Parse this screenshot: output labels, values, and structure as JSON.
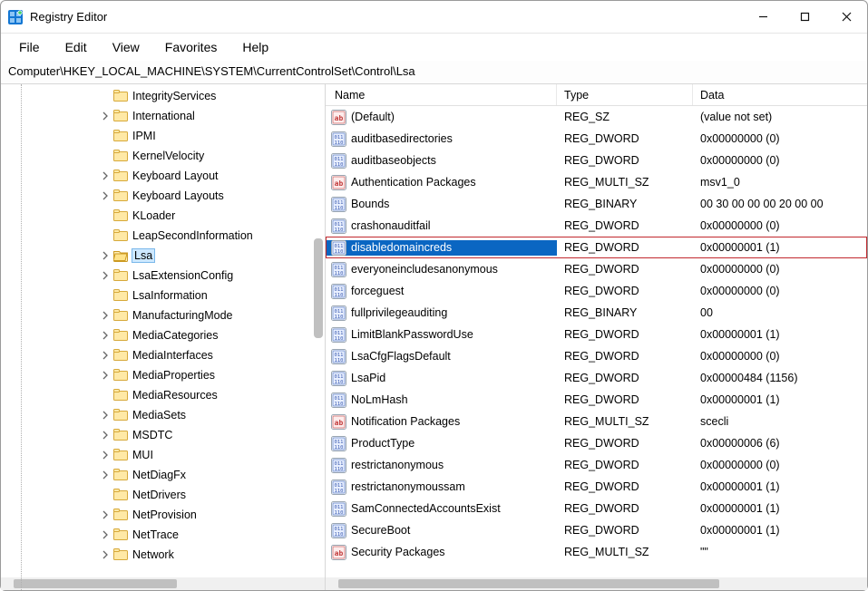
{
  "titlebar": {
    "title": "Registry Editor"
  },
  "menu": {
    "file": "File",
    "edit": "Edit",
    "view": "View",
    "favorites": "Favorites",
    "help": "Help"
  },
  "addressbar": {
    "path": "Computer\\HKEY_LOCAL_MACHINE\\SYSTEM\\CurrentControlSet\\Control\\Lsa"
  },
  "tree": {
    "items": [
      {
        "label": "IntegrityServices",
        "expandable": false
      },
      {
        "label": "International",
        "expandable": true
      },
      {
        "label": "IPMI",
        "expandable": false
      },
      {
        "label": "KernelVelocity",
        "expandable": false
      },
      {
        "label": "Keyboard Layout",
        "expandable": true
      },
      {
        "label": "Keyboard Layouts",
        "expandable": true
      },
      {
        "label": "KLoader",
        "expandable": false
      },
      {
        "label": "LeapSecondInformation",
        "expandable": false
      },
      {
        "label": "Lsa",
        "expandable": true,
        "selected": true
      },
      {
        "label": "LsaExtensionConfig",
        "expandable": true
      },
      {
        "label": "LsaInformation",
        "expandable": false
      },
      {
        "label": "ManufacturingMode",
        "expandable": true
      },
      {
        "label": "MediaCategories",
        "expandable": true
      },
      {
        "label": "MediaInterfaces",
        "expandable": true
      },
      {
        "label": "MediaProperties",
        "expandable": true
      },
      {
        "label": "MediaResources",
        "expandable": false
      },
      {
        "label": "MediaSets",
        "expandable": true
      },
      {
        "label": "MSDTC",
        "expandable": true
      },
      {
        "label": "MUI",
        "expandable": true
      },
      {
        "label": "NetDiagFx",
        "expandable": true
      },
      {
        "label": "NetDrivers",
        "expandable": false
      },
      {
        "label": "NetProvision",
        "expandable": true
      },
      {
        "label": "NetTrace",
        "expandable": true
      },
      {
        "label": "Network",
        "expandable": true
      }
    ]
  },
  "list": {
    "columns": {
      "name": "Name",
      "type": "Type",
      "data": "Data"
    },
    "rows": [
      {
        "icon": "string",
        "name": "(Default)",
        "type": "REG_SZ",
        "data": "(value not set)"
      },
      {
        "icon": "binary",
        "name": "auditbasedirectories",
        "type": "REG_DWORD",
        "data": "0x00000000 (0)"
      },
      {
        "icon": "binary",
        "name": "auditbaseobjects",
        "type": "REG_DWORD",
        "data": "0x00000000 (0)"
      },
      {
        "icon": "string",
        "name": "Authentication Packages",
        "type": "REG_MULTI_SZ",
        "data": "msv1_0"
      },
      {
        "icon": "binary",
        "name": "Bounds",
        "type": "REG_BINARY",
        "data": "00 30 00 00 00 20 00 00"
      },
      {
        "icon": "binary",
        "name": "crashonauditfail",
        "type": "REG_DWORD",
        "data": "0x00000000 (0)"
      },
      {
        "icon": "binary",
        "name": "disabledomaincreds",
        "type": "REG_DWORD",
        "data": "0x00000001 (1)",
        "selected": true,
        "highlight": true
      },
      {
        "icon": "binary",
        "name": "everyoneincludesanonymous",
        "type": "REG_DWORD",
        "data": "0x00000000 (0)"
      },
      {
        "icon": "binary",
        "name": "forceguest",
        "type": "REG_DWORD",
        "data": "0x00000000 (0)"
      },
      {
        "icon": "binary",
        "name": "fullprivilegeauditing",
        "type": "REG_BINARY",
        "data": "00"
      },
      {
        "icon": "binary",
        "name": "LimitBlankPasswordUse",
        "type": "REG_DWORD",
        "data": "0x00000001 (1)"
      },
      {
        "icon": "binary",
        "name": "LsaCfgFlagsDefault",
        "type": "REG_DWORD",
        "data": "0x00000000 (0)"
      },
      {
        "icon": "binary",
        "name": "LsaPid",
        "type": "REG_DWORD",
        "data": "0x00000484 (1156)"
      },
      {
        "icon": "binary",
        "name": "NoLmHash",
        "type": "REG_DWORD",
        "data": "0x00000001 (1)"
      },
      {
        "icon": "string",
        "name": "Notification Packages",
        "type": "REG_MULTI_SZ",
        "data": "scecli"
      },
      {
        "icon": "binary",
        "name": "ProductType",
        "type": "REG_DWORD",
        "data": "0x00000006 (6)"
      },
      {
        "icon": "binary",
        "name": "restrictanonymous",
        "type": "REG_DWORD",
        "data": "0x00000000 (0)"
      },
      {
        "icon": "binary",
        "name": "restrictanonymoussam",
        "type": "REG_DWORD",
        "data": "0x00000001 (1)"
      },
      {
        "icon": "binary",
        "name": "SamConnectedAccountsExist",
        "type": "REG_DWORD",
        "data": "0x00000001 (1)"
      },
      {
        "icon": "binary",
        "name": "SecureBoot",
        "type": "REG_DWORD",
        "data": "0x00000001 (1)"
      },
      {
        "icon": "string",
        "name": "Security Packages",
        "type": "REG_MULTI_SZ",
        "data": "\"\""
      }
    ]
  }
}
